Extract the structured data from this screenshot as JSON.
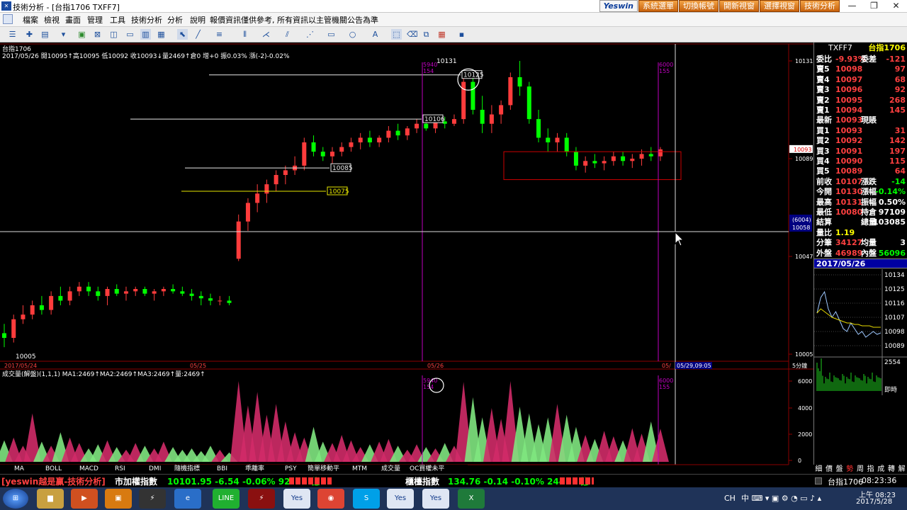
{
  "window": {
    "title": "技術分析 - [台指1706 TXFF7]",
    "brand": "Yeswin",
    "top_buttons": [
      "系統選單",
      "切換帳號",
      "開新視窗",
      "選擇視窗",
      "技術分析"
    ],
    "controls": [
      "—",
      "❐",
      "✕"
    ]
  },
  "menu": [
    "檔案",
    "檢視",
    "畫面",
    "管理",
    "工具",
    "技術分析",
    "分析",
    "說明",
    "報價資訊僅供參考, 所有資訊以主管機關公告為準"
  ],
  "chart": {
    "panel_title": "台指1706",
    "info_line": "2017/05/26 開10095↑高10095 低10092 收10093↓量2469↑倉0 增+0 振0.03% 漲(-2)-0.02%",
    "price_ticks": [
      "10131",
      "10089",
      "10047",
      "10005"
    ],
    "date_labels": [
      "2017/05/24",
      "05/25",
      "05/26",
      "05/"
    ],
    "crosshair_time": "05/29,09:05",
    "period": "5分鐘",
    "crosshair_price": "(6004)\n10058",
    "last_price": "10093",
    "hlines": [
      "10125",
      "10106",
      "10085",
      "10075"
    ],
    "high_note": "10131",
    "low_note": "10005",
    "vline_notes": [
      "5940\n154",
      "6000\n155"
    ],
    "volume_title": "成交量(解盤)(1,1,1) MA1:2469↑MA2:2469↑MA3:2469↑量:2469↑",
    "volume_ticks": [
      "6000",
      "4000",
      "2000",
      "0"
    ],
    "vol_vline_notes": [
      "5940\n154",
      "6000\n155"
    ],
    "indicator_tabs": [
      "MA",
      "BOLL",
      "MACD",
      "RSI",
      "DMI",
      "隨機指標",
      "BBI",
      "乖離率",
      "PSY",
      "簡單移動平",
      "MTM",
      "成交量",
      "OC買權未平"
    ]
  },
  "chart_data": {
    "type": "candlestick",
    "title": "台指1706",
    "ylim": [
      10005,
      10131
    ],
    "volume_ylim": [
      0,
      6000
    ],
    "candles": [
      [
        10014,
        10018,
        10008,
        10012
      ],
      [
        10012,
        10022,
        10010,
        10020
      ],
      [
        10020,
        10026,
        10018,
        10022
      ],
      [
        10022,
        10028,
        10020,
        10026
      ],
      [
        10026,
        10030,
        10022,
        10024
      ],
      [
        10024,
        10032,
        10022,
        10030
      ],
      [
        10030,
        10034,
        10026,
        10028
      ],
      [
        10028,
        10034,
        10026,
        10032
      ],
      [
        10032,
        10036,
        10030,
        10034
      ],
      [
        10034,
        10036,
        10030,
        10032
      ],
      [
        10032,
        10034,
        10028,
        10030
      ],
      [
        10030,
        10034,
        10026,
        10033
      ],
      [
        10033,
        10035,
        10030,
        10031
      ],
      [
        10031,
        10034,
        10028,
        10032
      ],
      [
        10032,
        10034,
        10030,
        10033
      ],
      [
        10033,
        10034,
        10030,
        10031
      ],
      [
        10031,
        10033,
        10028,
        10032
      ],
      [
        10032,
        10034,
        10030,
        10033
      ],
      [
        10033,
        10035,
        10031,
        10032
      ],
      [
        10032,
        10034,
        10030,
        10031
      ],
      [
        10031,
        10033,
        10028,
        10030
      ],
      [
        10030,
        10032,
        10026,
        10029
      ],
      [
        10029,
        10031,
        10026,
        10028
      ],
      [
        10028,
        10030,
        10026,
        10028
      ],
      [
        10028,
        10030,
        10026,
        10027
      ],
      [
        10046,
        10065,
        10045,
        10062
      ],
      [
        10062,
        10072,
        10058,
        10070
      ],
      [
        10070,
        10078,
        10066,
        10074
      ],
      [
        10074,
        10080,
        10070,
        10078
      ],
      [
        10078,
        10084,
        10075,
        10082
      ],
      [
        10082,
        10086,
        10078,
        10084
      ],
      [
        10084,
        10090,
        10082,
        10086
      ],
      [
        10086,
        10098,
        10084,
        10096
      ],
      [
        10096,
        10099,
        10090,
        10092
      ],
      [
        10092,
        10094,
        10088,
        10090
      ],
      [
        10090,
        10094,
        10087,
        10092
      ],
      [
        10092,
        10096,
        10090,
        10094
      ],
      [
        10094,
        10098,
        10092,
        10096
      ],
      [
        10096,
        10100,
        10093,
        10098
      ],
      [
        10098,
        10101,
        10094,
        10096
      ],
      [
        10096,
        10099,
        10094,
        10098
      ],
      [
        10098,
        10103,
        10096,
        10101
      ],
      [
        10101,
        10104,
        10097,
        10099
      ],
      [
        10099,
        10103,
        10097,
        10102
      ],
      [
        10102,
        10106,
        10100,
        10104
      ],
      [
        10104,
        10105,
        10101,
        10102
      ],
      [
        10102,
        10106,
        10100,
        10105
      ],
      [
        10105,
        10107,
        10102,
        10104
      ],
      [
        10104,
        10108,
        10103,
        10106
      ],
      [
        10106,
        10126,
        10104,
        10122
      ],
      [
        10122,
        10126,
        10108,
        10110
      ],
      [
        10110,
        10116,
        10100,
        10104
      ],
      [
        10104,
        10112,
        10100,
        10108
      ],
      [
        10108,
        10114,
        10104,
        10112
      ],
      [
        10112,
        10126,
        10110,
        10124
      ],
      [
        10124,
        10131,
        10116,
        10120
      ],
      [
        10120,
        10122,
        10104,
        10106
      ],
      [
        10106,
        10110,
        10096,
        10098
      ],
      [
        10098,
        10102,
        10092,
        10096
      ],
      [
        10096,
        10100,
        10092,
        10098
      ],
      [
        10098,
        10100,
        10090,
        10092
      ],
      [
        10092,
        10094,
        10084,
        10086
      ],
      [
        10086,
        10090,
        10083,
        10088
      ],
      [
        10088,
        10091,
        10085,
        10087
      ],
      [
        10087,
        10090,
        10084,
        10088
      ],
      [
        10088,
        10092,
        10086,
        10090
      ],
      [
        10090,
        10092,
        10086,
        10088
      ],
      [
        10088,
        10091,
        10085,
        10089
      ],
      [
        10089,
        10093,
        10086,
        10091
      ],
      [
        10091,
        10094,
        10088,
        10090
      ],
      [
        10090,
        10094,
        10088,
        10093
      ]
    ],
    "volume": [
      1600,
      1800,
      1200,
      3600,
      1500,
      1200,
      2200,
      1800,
      1400,
      1000,
      1300,
      1600,
      1100,
      900,
      1400,
      1200,
      1000,
      1500,
      1100,
      900,
      1000,
      800,
      1200,
      900,
      700,
      6000,
      4200,
      5200,
      3500,
      4300,
      3000,
      2200,
      1800,
      2600,
      1500,
      1400,
      2000,
      1600,
      1100,
      1300,
      1500,
      1700,
      1200,
      900,
      1300,
      1100,
      1000,
      1400,
      1200,
      5940,
      4800,
      3300,
      4000,
      3200,
      6000,
      4100,
      3600,
      2800,
      3300,
      4300,
      3500,
      2600,
      2000,
      1700,
      2300,
      1900,
      1600,
      2500,
      2100,
      3000,
      2469
    ]
  },
  "quotes": {
    "header_code": "TXFF7",
    "header_name": "台指1706",
    "rows": [
      {
        "l": "委比",
        "m": "-9.93%",
        "r1": "委差",
        "r": "-121",
        "color": "#ffffff",
        "vcolor": "#ff4040"
      },
      {
        "l": "賣5",
        "m": "10098",
        "r": "97",
        "vcolor": "#ff4040"
      },
      {
        "l": "賣4",
        "m": "10097",
        "r": "68",
        "vcolor": "#ff4040"
      },
      {
        "l": "賣3",
        "m": "10096",
        "r": "92",
        "vcolor": "#ff4040"
      },
      {
        "l": "賣2",
        "m": "10095",
        "r": "268",
        "vcolor": "#ff4040"
      },
      {
        "l": "賣1",
        "m": "10094",
        "r": "145",
        "vcolor": "#ff4040"
      },
      {
        "l": "最新",
        "m": "10093",
        "r1": "現賬",
        "r": "",
        "vcolor": "#00ff00"
      },
      {
        "l": "買1",
        "m": "10093",
        "r": "31",
        "vcolor": "#ff4040"
      },
      {
        "l": "買2",
        "m": "10092",
        "r": "142",
        "vcolor": "#ff4040"
      },
      {
        "l": "買3",
        "m": "10091",
        "r": "197",
        "vcolor": "#ff4040"
      },
      {
        "l": "買4",
        "m": "10090",
        "r": "115",
        "vcolor": "#ff4040"
      },
      {
        "l": "買5",
        "m": "10089",
        "r": "64",
        "vcolor": "#ff4040"
      },
      {
        "l": "前收",
        "m": "10107",
        "r1": "漲跌",
        "r": "-14",
        "vcolor": "#00ff00"
      },
      {
        "l": "今開",
        "m": "10130",
        "r1": "漲幅",
        "r": "-0.14%",
        "vcolor": "#00ff00"
      },
      {
        "l": "最高",
        "m": "10131",
        "r1": "振幅",
        "r": "0.50%",
        "vcolor": "#ffffff"
      },
      {
        "l": "最低",
        "m": "10080",
        "r1": "持倉",
        "r": "97109",
        "vcolor": "#ffffff"
      },
      {
        "l": "結算",
        "m": "",
        "r1": "總量",
        "r": "103085",
        "vcolor": "#ffffff"
      },
      {
        "l": "量比",
        "m": "1.19",
        "r1": "",
        "r": "",
        "vcolor": "#ffff00"
      },
      {
        "l": "分筆",
        "m": "34127",
        "r1": "均量",
        "r": "3",
        "vcolor": "#ffffff"
      },
      {
        "l": "外盤",
        "m": "46989",
        "r1": "內盤",
        "r": "56096",
        "vcolor": "#00ff00"
      }
    ],
    "date": "2017/05/26",
    "mini_ticks": [
      "10134",
      "10125",
      "10116",
      "10107",
      "10098",
      "10089"
    ],
    "mini_vol": "2554",
    "mini_label": "即時",
    "mini_prices": [
      10107,
      10118,
      10122,
      10110,
      10104,
      10108,
      10102,
      10096,
      10094,
      10100,
      10096,
      10092,
      10094,
      10090,
      10092,
      10094,
      10092,
      10093
    ],
    "mini_avg": [
      10107,
      10110,
      10108,
      10106,
      10104,
      10103,
      10102,
      10101,
      10100,
      10100,
      10099,
      10099,
      10098,
      10098,
      10098,
      10097,
      10097,
      10097
    ],
    "side_tabs": [
      "細",
      "價",
      "盤",
      "勢",
      "周",
      "指",
      "成",
      "轉",
      "解"
    ]
  },
  "ticker": {
    "brand": "[yeswin越是赢-技術分析]",
    "idx1_label": "市加權指數",
    "idx1_value": "10101.95 -6.54 -0.06% 920.14億",
    "idx2_label": "櫃檯指數",
    "idx2_value": "134.76 -0.14 -0.10% 244.17億",
    "symbol": "台指1706",
    "time": "08:23:36"
  },
  "taskbar": {
    "lang": "CH",
    "time": "上午 08:23",
    "date": "2017/5/28"
  }
}
